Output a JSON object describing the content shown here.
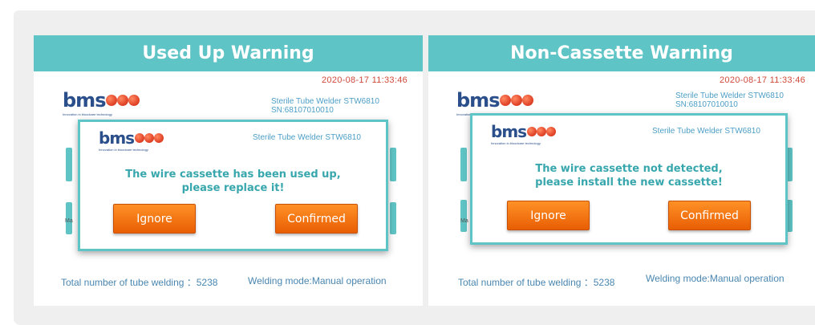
{
  "brand": {
    "logo_text": "bms",
    "tagline": "Innovation in bloodcare technology",
    "dot_color": "#e3472a",
    "accent": "#5fc4c5"
  },
  "panels": [
    {
      "title": "Used Up Warning",
      "datetime": "2020-08-17 11:33:46",
      "device_title": "Sterile Tube Welder STW6810",
      "serial": "SN:68107010010",
      "bg_partial_label": "Ma",
      "footer": {
        "total_welding": "Total number of tube welding ：5238",
        "welding_mode": "Welding mode:Manual operation"
      },
      "dialog": {
        "device_title": "Sterile Tube Welder STW6810",
        "message_line1": "The wire cassette has been used up,",
        "message_line2": "please replace it!",
        "ignore_label": "Ignore",
        "confirm_label": "Confirmed"
      }
    },
    {
      "title": "Non-Cassette Warning",
      "datetime": "2020-08-17 11:33:46",
      "device_title": "Sterile Tube Welder STW6810",
      "serial": "SN:68107010010",
      "bg_partial_label": "Ma",
      "footer": {
        "total_welding": "Total number of tube welding ：5238",
        "welding_mode": "Welding mode:Manual operation"
      },
      "dialog": {
        "device_title": "Sterile Tube Welder STW6810",
        "message_line1": "The wire cassette not detected,",
        "message_line2": "please install the new cassette!",
        "ignore_label": "Ignore",
        "confirm_label": "Confirmed"
      }
    }
  ]
}
